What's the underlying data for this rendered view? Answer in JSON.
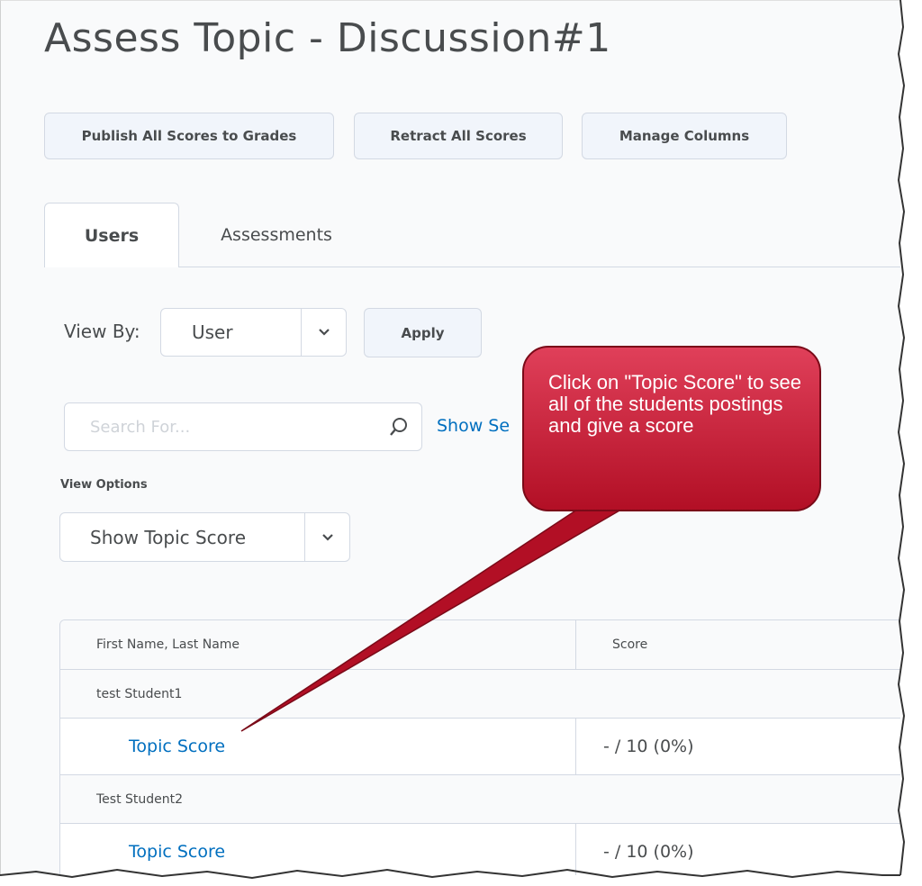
{
  "page": {
    "title": "Assess Topic - Discussion#1"
  },
  "toolbar": {
    "publish_label": "Publish All Scores to Grades",
    "retract_label": "Retract All Scores",
    "manage_label": "Manage Columns"
  },
  "tabs": [
    {
      "label": "Users",
      "active": true
    },
    {
      "label": "Assessments",
      "active": false
    }
  ],
  "view_by": {
    "label": "View By:",
    "selected": "User",
    "apply_label": "Apply"
  },
  "search": {
    "placeholder": "Search For...",
    "show_search_options": "Show Se"
  },
  "view_options": {
    "label": "View Options",
    "selected": "Show Topic Score"
  },
  "table": {
    "columns": [
      "First Name, Last Name",
      "Score"
    ],
    "groups": [
      {
        "name": "test Student1",
        "rows": [
          {
            "label": "Topic Score",
            "score": "- / 10 (0%)"
          }
        ]
      },
      {
        "name": "Test Student2",
        "rows": [
          {
            "label": "Topic Score",
            "score": "- / 10 (0%)"
          }
        ]
      }
    ]
  },
  "callout": {
    "text": "Click on \"Topic Score\" to see all of the students postings and give a score"
  },
  "colors": {
    "link": "#006fbf",
    "callout_fill": "#c8102e",
    "text": "#494c4e"
  },
  "icons": {
    "search": "magnifier-icon",
    "dropdown": "chevron-down-icon"
  }
}
